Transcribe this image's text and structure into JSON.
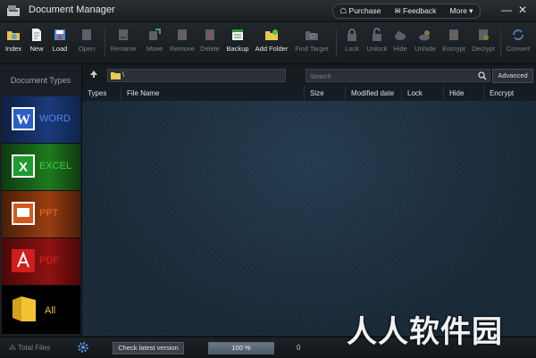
{
  "window": {
    "title": "Document Manager",
    "nav": {
      "purchase": "Purchase",
      "feedback": "Feedback",
      "more": "More ▾"
    },
    "minimize": "—",
    "close": "✕"
  },
  "toolbar": {
    "index": "Index",
    "new": "New",
    "load": "Load",
    "open": "Open",
    "rename": "Rename",
    "move": "Move",
    "remove": "Remove",
    "delete": "Delete",
    "backup": "Backup",
    "add_folder": "Add Folder",
    "find_target": "Find Target",
    "lock": "Lock",
    "unlock": "Unlock",
    "hide": "Hide",
    "unhide": "Unhide",
    "encrypt": "Encrypt",
    "decrypt": "Decrypt",
    "convert": "Convert"
  },
  "sidebar": {
    "heading": "Document Types",
    "items": [
      {
        "label": "WORD",
        "color": "#3d6fd6"
      },
      {
        "label": "EXCEL",
        "color": "#2fb82f"
      },
      {
        "label": "PPT",
        "color": "#e0602a"
      },
      {
        "label": "PDF",
        "color": "#d42020"
      },
      {
        "label": "All",
        "color": "#f1c232"
      }
    ]
  },
  "pathbar": {
    "path": "\\",
    "search_placeholder": "Search",
    "advanced": "Advanced"
  },
  "table": {
    "columns": [
      "Types",
      "File Name",
      "Size",
      "Modified date",
      "Lock",
      "Hide",
      "Encrypt"
    ]
  },
  "status": {
    "total_files": "Total Files",
    "check_version": "Check latest version",
    "zoom": "100 %",
    "count": "0"
  },
  "watermark": "人人软件园"
}
